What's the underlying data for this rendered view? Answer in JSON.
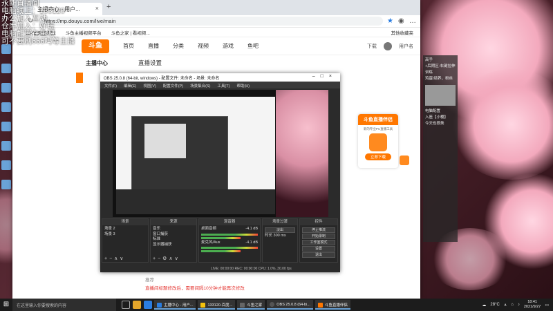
{
  "overlay_text": [
    "永新直播间",
    "电脑线上：133120",
    "办公加入互动",
    "仓库加入：好玩",
    "电脑配置在鱼吧",
    "可不要刷666吗等主播"
  ],
  "browser": {
    "tab_title": "主播中心 - 用户...",
    "url": "https://mp.douyu.com/live/main",
    "bookmarks": [
      "[斗鱼]网络游戏",
      "斗鱼主播视频平台",
      "斗鱼之家 | 看视频..."
    ],
    "bookmarks_folder": "其他收藏夹"
  },
  "douyu": {
    "logo": "斗鱼",
    "nav": [
      "首页",
      "直播",
      "分类",
      "视频",
      "游戏",
      "鱼吧"
    ],
    "user": {
      "download": "下载",
      "name": "用户名"
    },
    "sidebar_title": "主播中心",
    "page_title": "直播设置",
    "tips": {
      "line1": "推荐",
      "warn": "直播间标题修改后，需要间隔10分钟才能再次修改"
    }
  },
  "promo": {
    "title": "斗鱼直播伴侣",
    "subtitle": "新的专业PC直播工具",
    "button": "立即下载"
  },
  "obs": {
    "title": "OBS 25.0.8 (64-bit, windows) - 配置文件: 未命名 - 场景: 未命名",
    "menu": [
      "文件(F)",
      "编辑(E)",
      "视图(V)",
      "配置文件(P)",
      "场景集合(S)",
      "工具(T)",
      "帮助(H)"
    ],
    "docks": {
      "scenes": {
        "header": "场景",
        "items": [
          "场景 2",
          "场景 3"
        ]
      },
      "sources": {
        "header": "来源",
        "items": [
          "音乐",
          "窗口捕获",
          "标准",
          "显示器捕获"
        ]
      },
      "mixer": {
        "header": "混音器",
        "items": [
          {
            "name": "桌面音频",
            "level": "-4.1 dB"
          },
          {
            "name": "麦克风/Aux",
            "level": "-4.1 dB"
          }
        ]
      },
      "transitions": {
        "header": "场景过渡",
        "type": "淡出",
        "duration_label": "时长",
        "duration": "300 ms"
      },
      "controls": {
        "header": "控件",
        "buttons": [
          "停止推流",
          "开始录制",
          "工作室模式",
          "设置",
          "退出"
        ]
      }
    },
    "status": "LIVE: 00:00:00   REC: 00:00:00   CPU: 1.0%, 30.00 fps"
  },
  "chat": [
    "高手",
    "+后期区-右键拉伸训练",
    "鸡蛋/培养，粉丝",
    "电脑配置",
    "入座【小樱】",
    "今天也很美"
  ],
  "taskbar": {
    "search_placeholder": "在这里输入你要搜索的内容",
    "tasks": [
      {
        "label": "主播中心 - 用户...",
        "color": "#2a7de1"
      },
      {
        "label": "133120-百度...",
        "color": "#f4c20d"
      },
      {
        "label": "斗鱼之家",
        "color": "#2f2f2f"
      },
      {
        "label": "OBS 25.0.8 (64-bi...",
        "color": "#444"
      },
      {
        "label": "斗鱼直播伴侣",
        "color": "#ff7700"
      }
    ],
    "weather": "28°C",
    "time": "18:41",
    "date": "2021/9/27"
  }
}
